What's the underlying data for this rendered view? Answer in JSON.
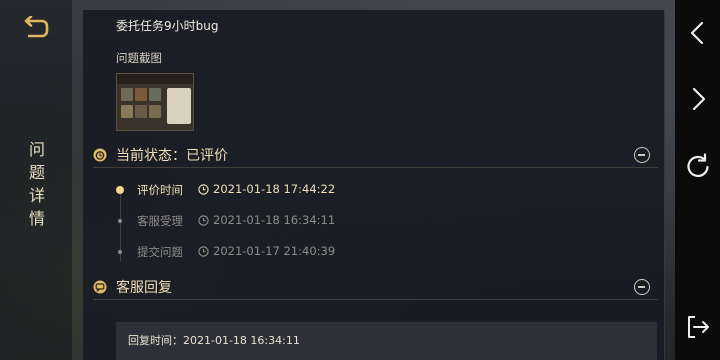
{
  "window": {
    "vertical_title": [
      "问",
      "题",
      "详",
      "情"
    ]
  },
  "task": {
    "title": "委托任务9小时bug"
  },
  "screenshot_section": {
    "label": "问题截图"
  },
  "status_section": {
    "title": "当前状态：已评价",
    "timeline": [
      {
        "label": "评价时间",
        "time": "2021-01-18 17:44:22",
        "active": true
      },
      {
        "label": "客服受理",
        "time": "2021-01-18 16:34:11",
        "active": false
      },
      {
        "label": "提交问题",
        "time": "2021-01-17 21:40:39",
        "active": false
      }
    ]
  },
  "reply_section": {
    "title": "客服回复",
    "reply_time": "回复时间：2021-01-18 16:34:11"
  },
  "icons": {
    "back": "back-arrow-icon",
    "prev": "chevron-left-icon",
    "next": "chevron-right-icon",
    "refresh": "refresh-icon",
    "exit": "exit-icon",
    "status": "status-icon",
    "reply": "chat-bubble-icon",
    "collapse": "collapse-minus-icon",
    "clock": "clock-icon"
  },
  "colors": {
    "accent_gold": "#e0b96a",
    "active_text": "#f0dfb8",
    "inactive_text": "#8e8c88",
    "panel_bg": "#181b22"
  }
}
